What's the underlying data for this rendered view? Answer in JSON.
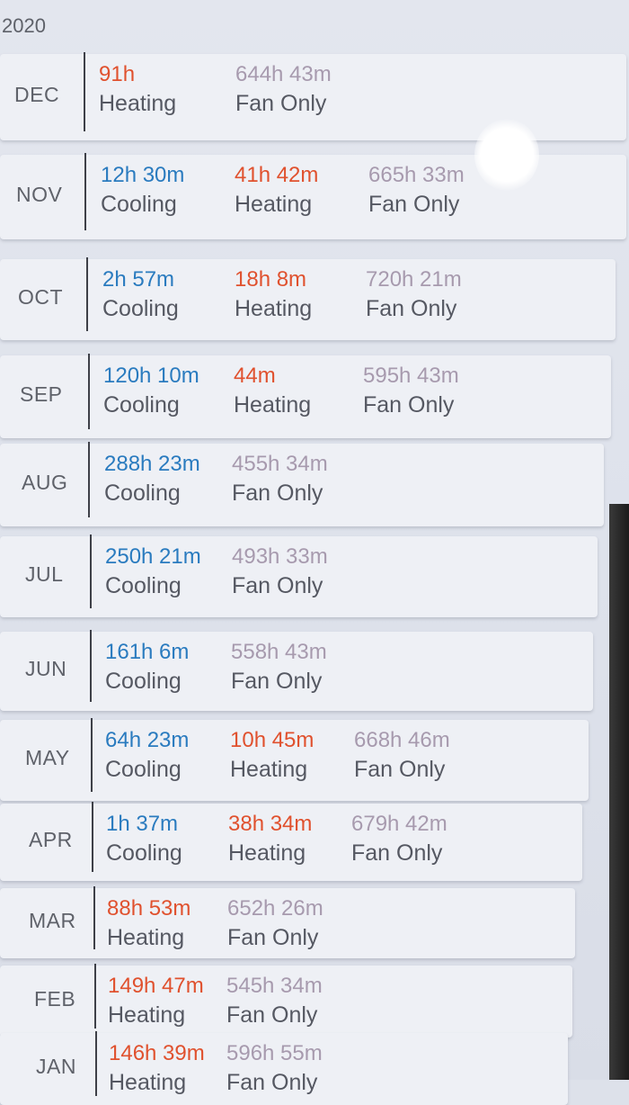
{
  "year": "2020",
  "colors": {
    "cooling": "#2a7bbf",
    "heating": "#e0512e",
    "fan_only": "#a79aae"
  },
  "months": [
    {
      "month": "DEC",
      "stats": [
        {
          "value": "91h",
          "label": "Heating",
          "type": "heat"
        },
        {
          "value": "644h 43m",
          "label": "Fan Only",
          "type": "fan"
        }
      ]
    },
    {
      "month": "NOV",
      "stats": [
        {
          "value": "12h 30m",
          "label": "Cooling",
          "type": "cool"
        },
        {
          "value": "41h 42m",
          "label": "Heating",
          "type": "heat"
        },
        {
          "value": "665h 33m",
          "label": "Fan Only",
          "type": "fan"
        }
      ]
    },
    {
      "month": "OCT",
      "stats": [
        {
          "value": "2h 57m",
          "label": "Cooling",
          "type": "cool"
        },
        {
          "value": "18h 8m",
          "label": "Heating",
          "type": "heat"
        },
        {
          "value": "720h 21m",
          "label": "Fan Only",
          "type": "fan"
        }
      ]
    },
    {
      "month": "SEP",
      "stats": [
        {
          "value": "120h 10m",
          "label": "Cooling",
          "type": "cool"
        },
        {
          "value": "44m",
          "label": "Heating",
          "type": "heat"
        },
        {
          "value": "595h 43m",
          "label": "Fan Only",
          "type": "fan"
        }
      ]
    },
    {
      "month": "AUG",
      "stats": [
        {
          "value": "288h 23m",
          "label": "Cooling",
          "type": "cool"
        },
        {
          "value": "455h 34m",
          "label": "Fan Only",
          "type": "fan"
        }
      ]
    },
    {
      "month": "JUL",
      "stats": [
        {
          "value": "250h 21m",
          "label": "Cooling",
          "type": "cool"
        },
        {
          "value": "493h 33m",
          "label": "Fan Only",
          "type": "fan"
        }
      ]
    },
    {
      "month": "JUN",
      "stats": [
        {
          "value": "161h 6m",
          "label": "Cooling",
          "type": "cool"
        },
        {
          "value": "558h 43m",
          "label": "Fan Only",
          "type": "fan"
        }
      ]
    },
    {
      "month": "MAY",
      "stats": [
        {
          "value": "64h 23m",
          "label": "Cooling",
          "type": "cool"
        },
        {
          "value": "10h 45m",
          "label": "Heating",
          "type": "heat"
        },
        {
          "value": "668h 46m",
          "label": "Fan Only",
          "type": "fan"
        }
      ]
    },
    {
      "month": "APR",
      "stats": [
        {
          "value": "1h 37m",
          "label": "Cooling",
          "type": "cool"
        },
        {
          "value": "38h 34m",
          "label": "Heating",
          "type": "heat"
        },
        {
          "value": "679h 42m",
          "label": "Fan Only",
          "type": "fan"
        }
      ]
    },
    {
      "month": "MAR",
      "stats": [
        {
          "value": "88h 53m",
          "label": "Heating",
          "type": "heat"
        },
        {
          "value": "652h 26m",
          "label": "Fan Only",
          "type": "fan"
        }
      ]
    },
    {
      "month": "FEB",
      "stats": [
        {
          "value": "149h 47m",
          "label": "Heating",
          "type": "heat"
        },
        {
          "value": "545h 34m",
          "label": "Fan Only",
          "type": "fan"
        }
      ]
    },
    {
      "month": "JAN",
      "stats": [
        {
          "value": "146h 39m",
          "label": "Heating",
          "type": "heat"
        },
        {
          "value": "596h 55m",
          "label": "Fan Only",
          "type": "fan"
        }
      ]
    }
  ]
}
